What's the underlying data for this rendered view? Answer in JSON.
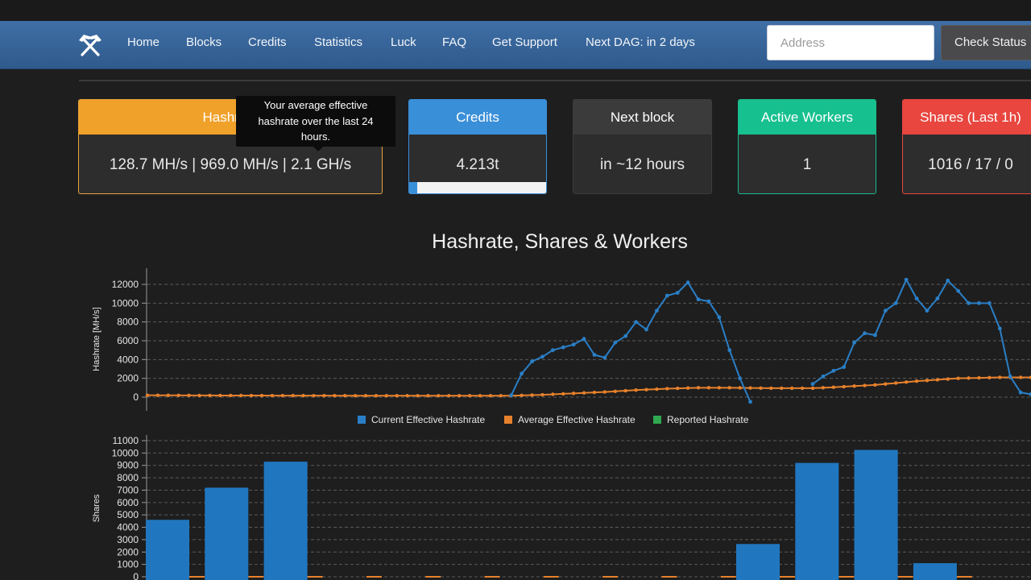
{
  "nav": {
    "items": [
      "Home",
      "Blocks",
      "Credits",
      "Statistics",
      "Luck",
      "FAQ",
      "Get Support",
      "Next DAG: in 2 days"
    ],
    "address_placeholder": "Address",
    "check_status_label": "Check Status"
  },
  "cards": {
    "hashrate": {
      "label": "Hashrate",
      "value": "128.7 MH/s | 969.0 MH/s | 2.1 GH/s"
    },
    "credits": {
      "label": "Credits",
      "value": "4.213t",
      "progress": 0.06
    },
    "next_block": {
      "label": "Next block",
      "value": "in ~12 hours"
    },
    "workers": {
      "label": "Active Workers",
      "value": "1"
    },
    "shares": {
      "label": "Shares (Last 1h)",
      "value": "1016 / 17 / 0"
    }
  },
  "tooltip": {
    "lines": [
      "Your average effective",
      "hashrate over the last 24",
      "hours."
    ]
  },
  "chart_title": "Hashrate, Shares & Workers",
  "colors": {
    "current": "#2a7fc6",
    "average": "#e8812b",
    "reported": "#2fa84f",
    "shares_bar": "#2077c0"
  },
  "chart_data": [
    {
      "type": "line",
      "ylabel": "Hashrate [MH/s]",
      "ylim": [
        0,
        12000
      ],
      "yticks": [
        0,
        2000,
        4000,
        6000,
        8000,
        10000,
        12000
      ],
      "grid": true,
      "legend_position": "bottom",
      "legend": [
        "Current Effective Hashrate",
        "Average Effective Hashrate",
        "Reported Hashrate"
      ],
      "x_index_range": [
        0,
        72
      ],
      "series": [
        {
          "name": "Current Effective Hashrate",
          "segments": [
            [
              [
                35,
                200
              ],
              [
                36,
                2500
              ],
              [
                37,
                3800
              ],
              [
                38,
                4300
              ],
              [
                39,
                5000
              ],
              [
                40,
                5300
              ],
              [
                41,
                5600
              ],
              [
                42,
                6200
              ],
              [
                43,
                4500
              ],
              [
                44,
                4200
              ],
              [
                45,
                5800
              ],
              [
                46,
                6500
              ],
              [
                47,
                8000
              ],
              [
                48,
                7200
              ],
              [
                49,
                9200
              ],
              [
                50,
                10800
              ],
              [
                51,
                11100
              ],
              [
                52,
                12200
              ],
              [
                53,
                10400
              ],
              [
                54,
                10200
              ],
              [
                55,
                8500
              ],
              [
                56,
                5000
              ],
              [
                57,
                2000
              ],
              [
                58,
                -500
              ]
            ],
            [
              [
                64,
                1400
              ],
              [
                65,
                2200
              ],
              [
                66,
                2800
              ],
              [
                67,
                3200
              ],
              [
                68,
                5800
              ],
              [
                69,
                6800
              ],
              [
                70,
                6600
              ],
              [
                71,
                9200
              ],
              [
                72,
                10000
              ],
              [
                73,
                12500
              ],
              [
                74,
                10500
              ],
              [
                75,
                9200
              ],
              [
                76,
                10500
              ],
              [
                77,
                12400
              ],
              [
                78,
                11300
              ],
              [
                79,
                10000
              ],
              [
                80,
                10000
              ],
              [
                81,
                10000
              ],
              [
                82,
                7300
              ],
              [
                83,
                2200
              ],
              [
                84,
                500
              ],
              [
                85,
                300
              ]
            ]
          ]
        },
        {
          "name": "Average Effective Hashrate",
          "points": [
            [
              0,
              200
            ],
            [
              5,
              180
            ],
            [
              10,
              170
            ],
            [
              15,
              160
            ],
            [
              20,
              150
            ],
            [
              25,
              150
            ],
            [
              30,
              150
            ],
            [
              35,
              150
            ],
            [
              38,
              250
            ],
            [
              41,
              400
            ],
            [
              44,
              550
            ],
            [
              47,
              750
            ],
            [
              50,
              900
            ],
            [
              53,
              1000
            ],
            [
              56,
              1000
            ],
            [
              60,
              950
            ],
            [
              64,
              950
            ],
            [
              66,
              1050
            ],
            [
              70,
              1300
            ],
            [
              74,
              1700
            ],
            [
              78,
              2000
            ],
            [
              82,
              2100
            ],
            [
              85,
              2100
            ]
          ]
        }
      ]
    },
    {
      "type": "bar",
      "ylabel": "Shares",
      "ylim": [
        0,
        11000
      ],
      "yticks": [
        0,
        1000,
        2000,
        3000,
        4000,
        5000,
        6000,
        7000,
        8000,
        9000,
        10000,
        11000
      ],
      "grid": true,
      "bars": [
        {
          "slot": 0,
          "value": 4600
        },
        {
          "slot": 1,
          "value": 7200
        },
        {
          "slot": 2,
          "value": 9300
        },
        {
          "slot": 10,
          "value": 2650
        },
        {
          "slot": 11,
          "value": 9200
        },
        {
          "slot": 12,
          "value": 10250
        },
        {
          "slot": 13,
          "value": 1100
        }
      ]
    }
  ]
}
